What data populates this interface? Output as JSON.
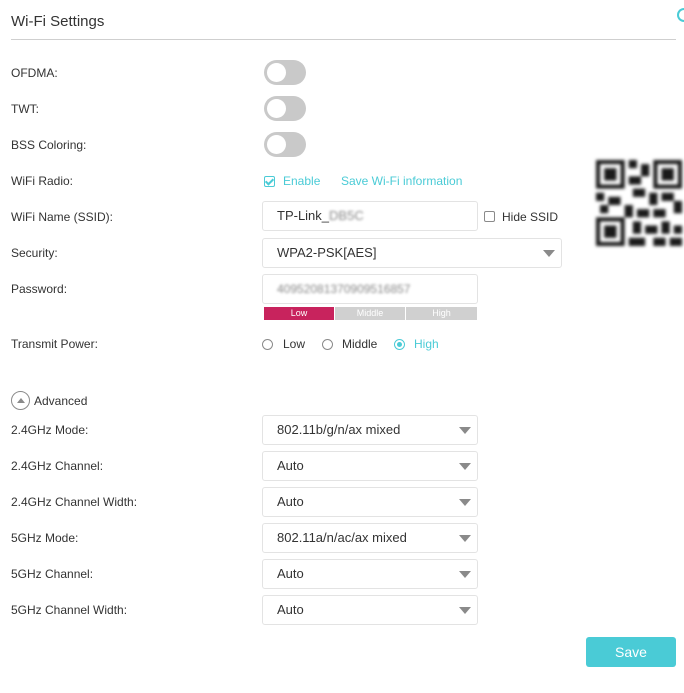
{
  "page": {
    "title": "Wi-Fi Settings"
  },
  "basic": {
    "ofdma_label": "OFDMA:",
    "twt_label": "TWT:",
    "bss_coloring_label": "BSS Coloring:",
    "wifi_radio_label": "WiFi Radio:",
    "enable_label": "Enable",
    "save_wifi_info_label": "Save Wi-Fi information",
    "ssid_label": "WiFi Name (SSID):",
    "ssid_value_visible": "TP-Link_",
    "ssid_value_blurred": "DB5C",
    "hide_ssid_label": "Hide SSID",
    "security_label": "Security:",
    "security_value": "WPA2-PSK[AES]",
    "password_label": "Password:",
    "password_value": "40952081370909516857",
    "strength_low": "Low",
    "strength_middle": "Middle",
    "strength_high": "High",
    "transmit_power_label": "Transmit Power:",
    "power_low": "Low",
    "power_middle": "Middle",
    "power_high": "High"
  },
  "toggles": {
    "ofdma": false,
    "twt": false,
    "bss_coloring": false
  },
  "checkboxes": {
    "enable": true,
    "hide_ssid": false
  },
  "transmit_power_selected": "High",
  "advanced": {
    "toggle_label": "Advanced",
    "mode_24_label": "2.4GHz Mode:",
    "mode_24_value": "802.11b/g/n/ax mixed",
    "channel_24_label": "2.4GHz Channel:",
    "channel_24_value": "Auto",
    "width_24_label": "2.4GHz Channel Width:",
    "width_24_value": "Auto",
    "mode_5_label": "5GHz Mode:",
    "mode_5_value": "802.11a/n/ac/ax mixed",
    "channel_5_label": "5GHz Channel:",
    "channel_5_value": "Auto",
    "width_5_label": "5GHz Channel Width:",
    "width_5_value": "Auto"
  },
  "actions": {
    "save_label": "Save"
  },
  "colors": {
    "accent": "#4acbd6",
    "strength_low_active": "#c8235d",
    "strength_inactive": "#d0d0d0",
    "toggle_off": "#c9c9c9"
  },
  "icons": {
    "advanced": "chevron-up-circle-icon",
    "qr": "qr-code-icon"
  }
}
